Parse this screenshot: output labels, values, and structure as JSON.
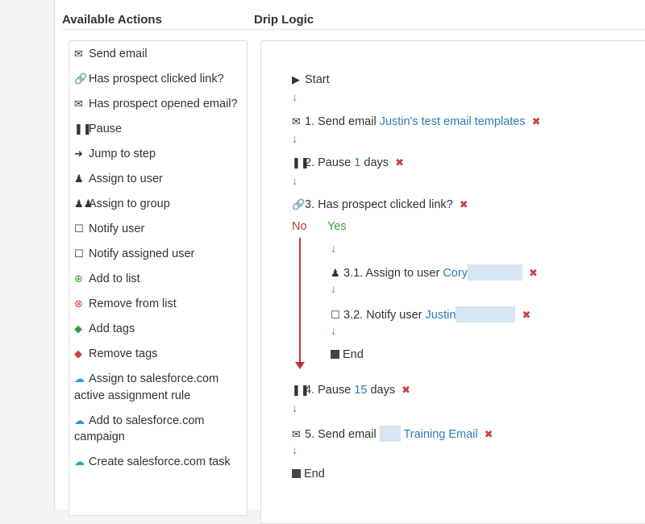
{
  "headers": {
    "available_actions": "Available Actions",
    "drip_logic": "Drip Logic"
  },
  "actions": [
    {
      "label": "Send email",
      "icon": "envelope-icon"
    },
    {
      "label": "Has prospect clicked link?",
      "icon": "link-icon"
    },
    {
      "label": "Has prospect opened email?",
      "icon": "envelope-icon"
    },
    {
      "label": "Pause",
      "icon": "pause-icon"
    },
    {
      "label": "Jump to step",
      "icon": "arrow-right-icon"
    },
    {
      "label": "Assign to user",
      "icon": "user-icon"
    },
    {
      "label": "Assign to group",
      "icon": "group-icon"
    },
    {
      "label": "Notify user",
      "icon": "bell-icon"
    },
    {
      "label": "Notify assigned user",
      "icon": "bell-icon"
    },
    {
      "label": "Add to list",
      "icon": "plus-circle-icon"
    },
    {
      "label": "Remove from list",
      "icon": "x-circle-icon"
    },
    {
      "label": "Add tags",
      "icon": "tag-icon"
    },
    {
      "label": "Remove tags",
      "icon": "tag-icon"
    },
    {
      "label": "Assign to salesforce.com active assignment rule",
      "icon": "cloud-icon"
    },
    {
      "label": "Add to salesforce.com campaign",
      "icon": "cloud-icon"
    },
    {
      "label": "Create salesforce.com task",
      "icon": "cloud-icon"
    }
  ],
  "drip": {
    "start": "Start",
    "step1": {
      "text": "1. Send email",
      "link": "Justin's test email templates"
    },
    "step2": {
      "text": "2. Pause",
      "value": "1",
      "suffix": "days"
    },
    "step3": {
      "text": "3. Has prospect clicked link?"
    },
    "no_label": "No",
    "yes_label": "Yes",
    "step31": {
      "text": "3.1. Assign to user",
      "link": "Cory"
    },
    "step32": {
      "text": "3.2. Notify user",
      "link": "Justin"
    },
    "yes_end": "End",
    "step4": {
      "text": "4. Pause",
      "value": "15",
      "suffix": "days"
    },
    "step5": {
      "text": "5. Send email",
      "link": "Training Email"
    },
    "end": "End"
  },
  "colors": {
    "link": "#2b7cb8",
    "remove": "#c9413d",
    "arrow": "#3a9a3a",
    "no_branch": "#b83632"
  }
}
